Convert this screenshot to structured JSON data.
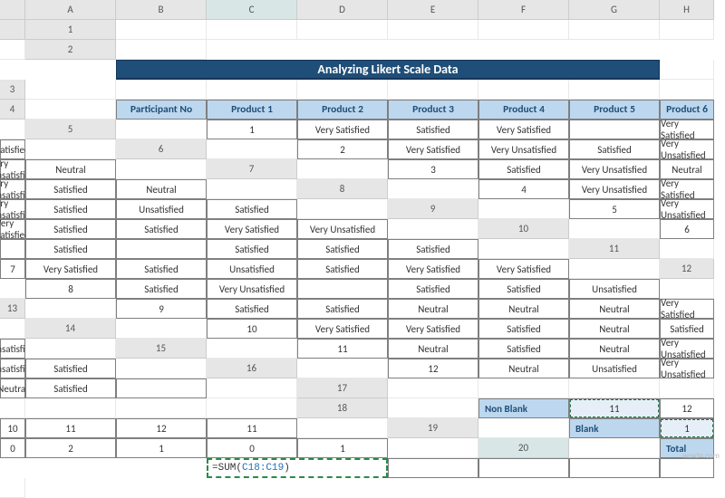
{
  "columns": [
    "A",
    "B",
    "C",
    "D",
    "E",
    "F",
    "G",
    "H"
  ],
  "row_count": 20,
  "title": "Analyzing Likert Scale Data",
  "headers": [
    "Participant No",
    "Product 1",
    "Product 2",
    "Product 3",
    "Product 4",
    "Product 5",
    "Product 6"
  ],
  "rows": [
    [
      "1",
      "Very Satisfied",
      "Satisfied",
      "Very Satisfied",
      "",
      "Very Satisfied",
      "Satisfied"
    ],
    [
      "2",
      "Very Satisfied",
      "Very Unsatisfied",
      "Satisfied",
      "Very Unsatisfied",
      "Very Unsatisfied",
      "Neutral"
    ],
    [
      "3",
      "Satisfied",
      "Very Unsatisfied",
      "Neutral",
      "Very Unsatisfied",
      "Satisfied",
      "Neutral"
    ],
    [
      "4",
      "Very Unsatisfied",
      "Very Satisfied",
      "Very Unsatisfied",
      "Satisfied",
      "Unsatisfied",
      "Satisfied"
    ],
    [
      "5",
      "Very Unsatisfied",
      "Very Satisfied",
      "Satisfied",
      "Satisfied",
      "Very Satisfied",
      "Very Unsatisfied"
    ],
    [
      "6",
      "",
      "Satisfied",
      "",
      "Satisfied",
      "Satisfied",
      "Satisfied"
    ],
    [
      "7",
      "Very Satisfied",
      "Satisfied",
      "Unsatisfied",
      "Satisfied",
      "Very Satisfied",
      "Very Satisfied"
    ],
    [
      "8",
      "Satisfied",
      "Very Unsatisfied",
      "",
      "Satisfied",
      "Satisfied",
      "Unsatisfied"
    ],
    [
      "9",
      "Satisfied",
      "Satisfied",
      "Neutral",
      "Neutral",
      "Neutral",
      "Very Satisfied"
    ],
    [
      "10",
      "Very Satisfied",
      "Very Satisfied",
      "Satisfied",
      "Neutral",
      "Satisfied",
      "Unsatisfied"
    ],
    [
      "11",
      "Neutral",
      "Satisfied",
      "Neutral",
      "Very Unsatisfied",
      "Unsatisfied",
      "Satisfied"
    ],
    [
      "12",
      "Neutral",
      "Unsatisfied",
      "Very Unsatisfied",
      "Neutral",
      "Satisfied",
      ""
    ]
  ],
  "summary": {
    "labels": {
      "non_blank": "Non Blank",
      "blank": "Blank",
      "total": "Total"
    },
    "non_blank": [
      "11",
      "12",
      "10",
      "11",
      "12",
      "11"
    ],
    "blank": [
      "1",
      "0",
      "2",
      "1",
      "0",
      "1"
    ]
  },
  "formula": {
    "prefix": "=SUM(",
    "ref": "C18:C19",
    "suffix": ")"
  },
  "selected": {
    "col": "C",
    "row": 20
  },
  "watermark": "wsxdn.com"
}
